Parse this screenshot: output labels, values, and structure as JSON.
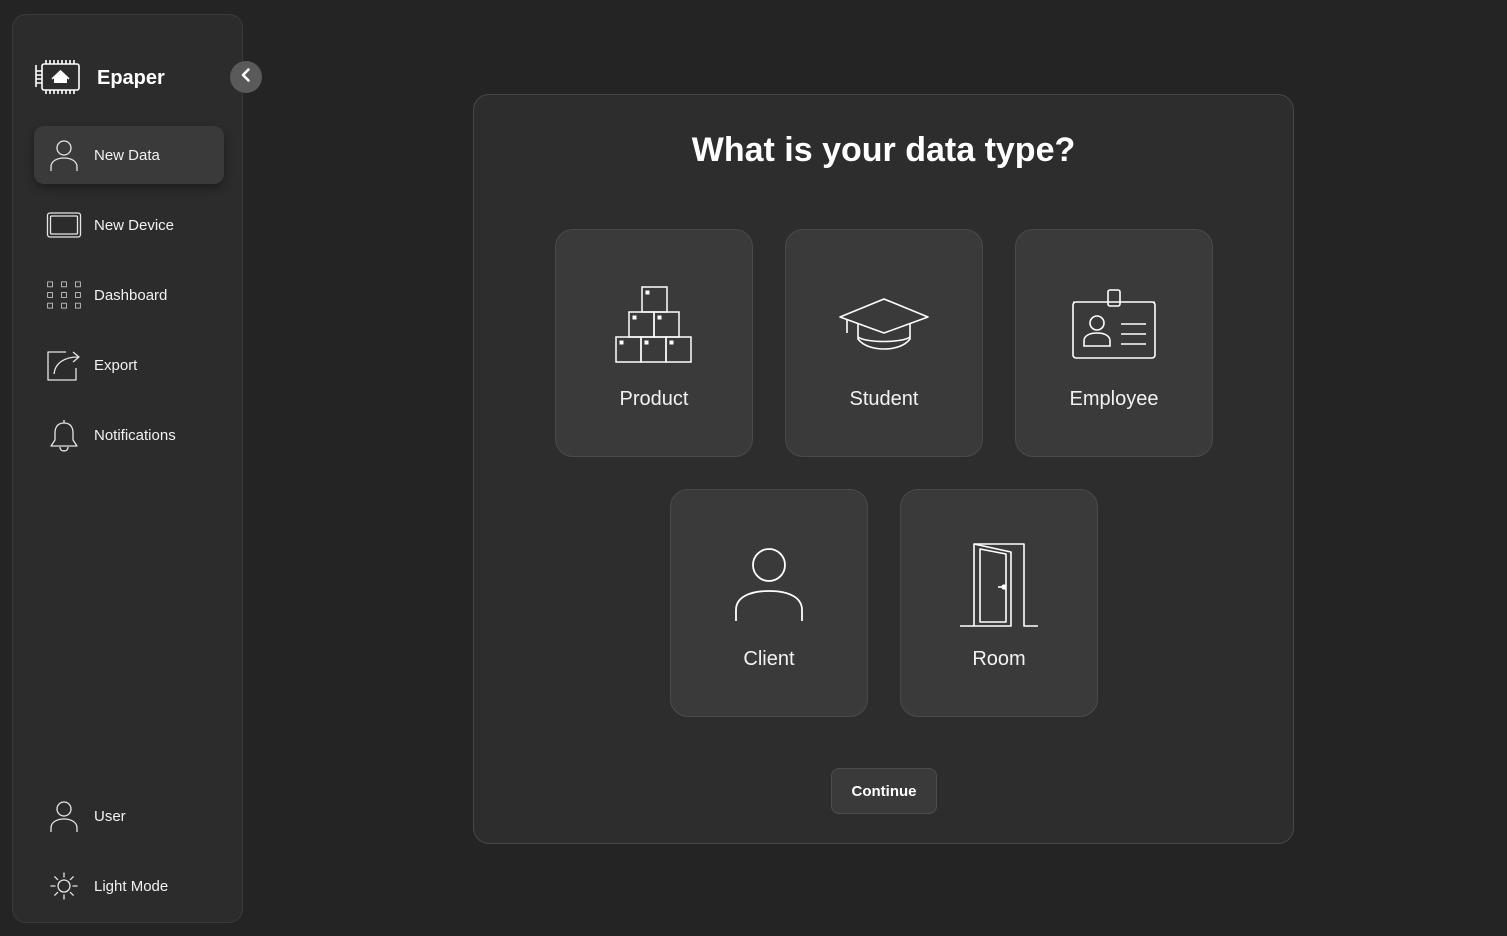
{
  "app": {
    "name": "Epaper"
  },
  "sidebar": {
    "collapse_icon": "chevron-left-icon",
    "items": [
      {
        "label": "New Data",
        "icon": "user-icon",
        "active": true
      },
      {
        "label": "New Device",
        "icon": "device-icon",
        "active": false
      },
      {
        "label": "Dashboard",
        "icon": "grid-icon",
        "active": false
      },
      {
        "label": "Export",
        "icon": "export-icon",
        "active": false
      },
      {
        "label": "Notifications",
        "icon": "bell-icon",
        "active": false
      }
    ],
    "bottom_items": [
      {
        "label": "User",
        "icon": "user-icon"
      },
      {
        "label": "Light Mode",
        "icon": "sun-icon"
      }
    ]
  },
  "main": {
    "title": "What is your data type?",
    "options": [
      {
        "label": "Product",
        "icon": "boxes-icon"
      },
      {
        "label": "Student",
        "icon": "graduation-cap-icon"
      },
      {
        "label": "Employee",
        "icon": "id-badge-icon"
      },
      {
        "label": "Client",
        "icon": "person-icon"
      },
      {
        "label": "Room",
        "icon": "door-icon"
      }
    ],
    "continue_label": "Continue"
  },
  "colors": {
    "background": "#242424",
    "sidebar": "#2c2c2c",
    "panel": "#2d2d2d",
    "card": "#3a3a3a",
    "text": "#ffffff"
  }
}
